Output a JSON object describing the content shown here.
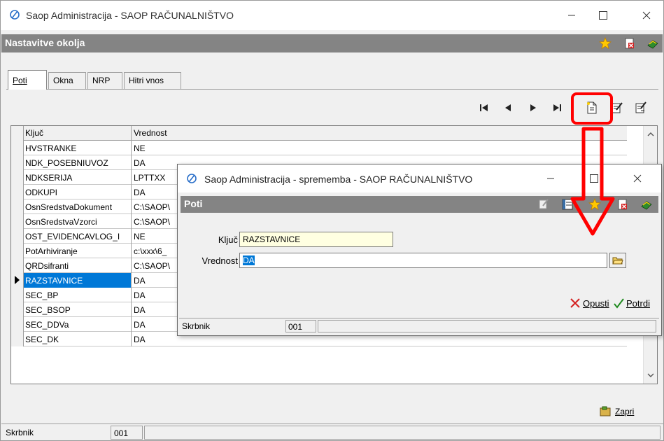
{
  "window": {
    "title": "Saop Administracija - SAOP RAČUNALNIŠTVO"
  },
  "header": {
    "title": "Nastavitve okolja"
  },
  "tabs": [
    {
      "label": "Poti"
    },
    {
      "label": "Okna"
    },
    {
      "label": "NRP"
    },
    {
      "label": "Hitri vnos"
    }
  ],
  "grid": {
    "columns": [
      "Ključ",
      "Vrednost"
    ],
    "rows": [
      {
        "key": "HVSTRANKE",
        "value": "NE"
      },
      {
        "key": "NDK_POSEBNIUVOZ",
        "value": "DA"
      },
      {
        "key": "NDKSERIJA",
        "value": "LPTTXX"
      },
      {
        "key": "ODKUPI",
        "value": "DA"
      },
      {
        "key": "OsnSredstvaDokument",
        "value": "C:\\SAOP\\"
      },
      {
        "key": "OsnSredstvaVzorci",
        "value": "C:\\SAOP\\"
      },
      {
        "key": "OST_EVIDENCAVLOG_I",
        "value": "NE"
      },
      {
        "key": "PotArhiviranje",
        "value": "c:\\xxx\\6_"
      },
      {
        "key": "QRDsifranti",
        "value": "C:\\SAOP\\"
      },
      {
        "key": "RAZSTAVNICE",
        "value": "DA"
      },
      {
        "key": "SEC_BP",
        "value": "DA"
      },
      {
        "key": "SEC_BSOP",
        "value": "DA"
      },
      {
        "key": "SEC_DDVa",
        "value": "DA"
      },
      {
        "key": "SEC_DK",
        "value": "DA"
      }
    ],
    "selected_index": 9
  },
  "footer": {
    "close_label": "Zapri"
  },
  "status": {
    "user_label": "Skrbnik",
    "code": "001"
  },
  "dialog": {
    "title": "Saop Administracija - sprememba - SAOP RAČUNALNIŠTVO",
    "header": "Poti",
    "key_label": "Ključ",
    "key_value": "RAZSTAVNICE",
    "value_label": "Vrednost",
    "value_value": "DA",
    "cancel_label": "Opusti",
    "confirm_label": "Potrdi",
    "status_user": "Skrbnik",
    "status_code": "001"
  },
  "colors": {
    "header_bg": "#848484",
    "selection": "#0078d7",
    "highlight": "#ff0000",
    "key_field_bg": "#ffffe1"
  }
}
